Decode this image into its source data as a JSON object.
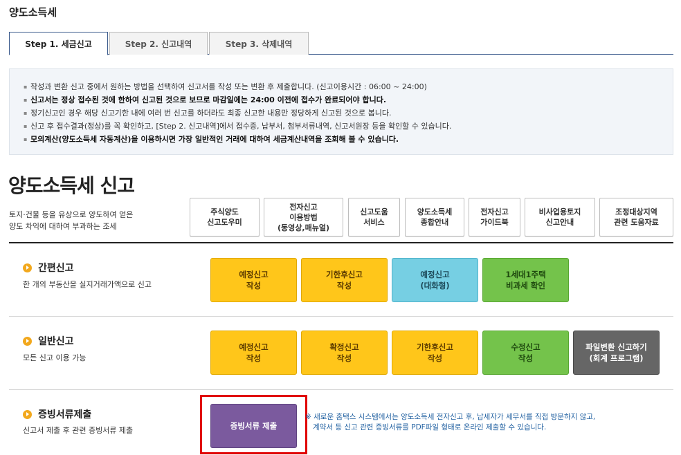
{
  "page_title": "양도소득세",
  "tabs": [
    {
      "label": "Step 1. 세금신고",
      "active": true
    },
    {
      "label": "Step 2. 신고내역",
      "active": false
    },
    {
      "label": "Step 3. 삭제내역",
      "active": false
    }
  ],
  "notice": [
    {
      "text": "작성과 변환 신고 중에서 원하는 방법을 선택하여 신고서를 작성 또는 변환 후 제출합니다. (신고이용시간 : 06:00 ~ 24:00)",
      "bold": false
    },
    {
      "text": "신고서는 정상 접수된 것에 한하여 신고된 것으로 보므로 마감일에는 24:00 이전에 접수가 완료되어야 합니다.",
      "bold": true
    },
    {
      "text": "정기신고인 경우 해당 신고기한 내에 여러 번 신고를 하더라도 최종 신고한 내용만 정당하게 신고된 것으로 봅니다.",
      "bold": false
    },
    {
      "text": "신고 후 접수결과(정상)를 꼭 확인하고, [Step 2. 신고내역]에서 접수증, 납부서, 첨부서류내역, 신고서원장 등을 확인할 수 있습니다.",
      "bold": false
    },
    {
      "text": "모의계산(양도소득세 자동계산)을 이용하시면 가장 일반적인 거래에 대하여 세금계산내역을 조회해 볼 수 있습니다.",
      "bold": true
    }
  ],
  "main": {
    "title": "양도소득세 신고",
    "desc_line1": "토지·건물 등을 유상으로 양도하여 얻은",
    "desc_line2": "양도 차익에 대하여 부과하는 조세"
  },
  "guide_buttons": [
    "주식양도\n신고도우미",
    "전자신고\n이용방법\n(동영상,매뉴얼)",
    "신고도움\n서비스",
    "양도소득세\n종합안내",
    "전자신고\n가이드북",
    "비사업용토지\n신고안내",
    "조정대상지역\n관련 도움자료"
  ],
  "sections": {
    "simple": {
      "title": "간편신고",
      "desc": "한 개의 부동산을 실지거래가액으로 신고",
      "buttons": [
        "예정신고\n작성",
        "기한후신고\n작성",
        "예정신고\n(대화형)",
        "1세대1주택\n비과세 확인"
      ]
    },
    "general": {
      "title": "일반신고",
      "desc": "모든 신고 이용 가능",
      "buttons": [
        "예정신고\n작성",
        "확정신고\n작성",
        "기한후신고\n작성",
        "수정신고\n작성",
        "파일변환 신고하기\n(회계 프로그램)"
      ]
    },
    "documents": {
      "title": "증빙서류제출",
      "desc": "신고서 제출 후 관련 증빙서류 제출",
      "button": "증빙서류 제출",
      "note_line1": "※ 새로운 홈택스 시스템에서는 양도소득세 전자신고 후, 납세자가 세무서를 직접 방문하지 않고,",
      "note_line2": "계약서 등 신고 관련 증빙서류를 PDF파일 형태로 온라인 제출할 수 있습니다."
    }
  },
  "colors": {
    "yellow": "#ffc61a",
    "blue": "#76cfe3",
    "green": "#74c34b",
    "gray": "#666666",
    "purple": "#7b5a9e",
    "highlight": "#e00000"
  }
}
